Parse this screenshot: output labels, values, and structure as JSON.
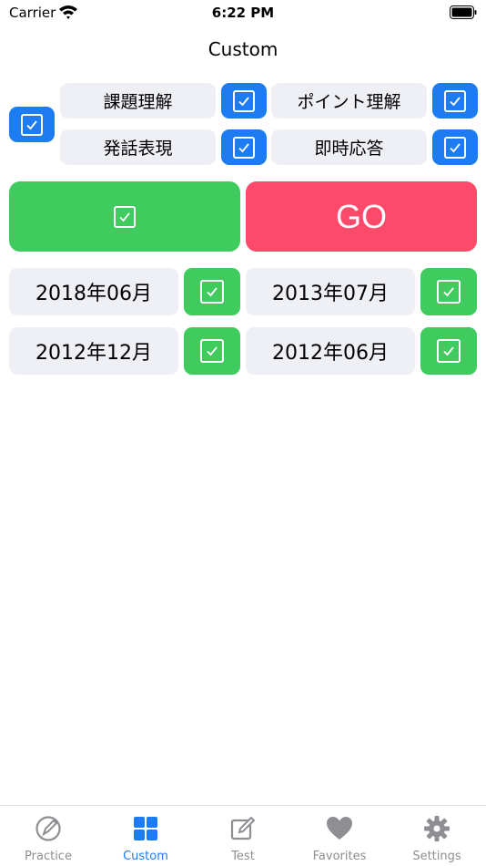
{
  "status_bar": {
    "carrier": "Carrier",
    "time": "6:22 PM"
  },
  "nav": {
    "title": "Custom"
  },
  "categories": [
    {
      "label": "課題理解",
      "checked": true
    },
    {
      "label": "ポイント理解",
      "checked": true
    },
    {
      "label": "発話表現",
      "checked": true
    },
    {
      "label": "即時応答",
      "checked": true
    }
  ],
  "select_all_checked": true,
  "actions": {
    "go_label": "GO",
    "select_all_dates_checked": true
  },
  "dates": [
    {
      "label": "2018年06月",
      "checked": true
    },
    {
      "label": "2013年07月",
      "checked": true
    },
    {
      "label": "2012年12月",
      "checked": true
    },
    {
      "label": "2012年06月",
      "checked": true
    }
  ],
  "tabs": [
    {
      "label": "Practice",
      "icon": "practice-icon",
      "active": false
    },
    {
      "label": "Custom",
      "icon": "grid-icon",
      "active": true
    },
    {
      "label": "Test",
      "icon": "edit-icon",
      "active": false
    },
    {
      "label": "Favorites",
      "icon": "heart-icon",
      "active": false
    },
    {
      "label": "Settings",
      "icon": "gear-icon",
      "active": false
    }
  ],
  "colors": {
    "blue": "#1e7cf2",
    "green": "#3fcb5d",
    "pink": "#fd4a6a",
    "label_bg": "#eff0f5",
    "tab_inactive": "#8e8e93"
  }
}
